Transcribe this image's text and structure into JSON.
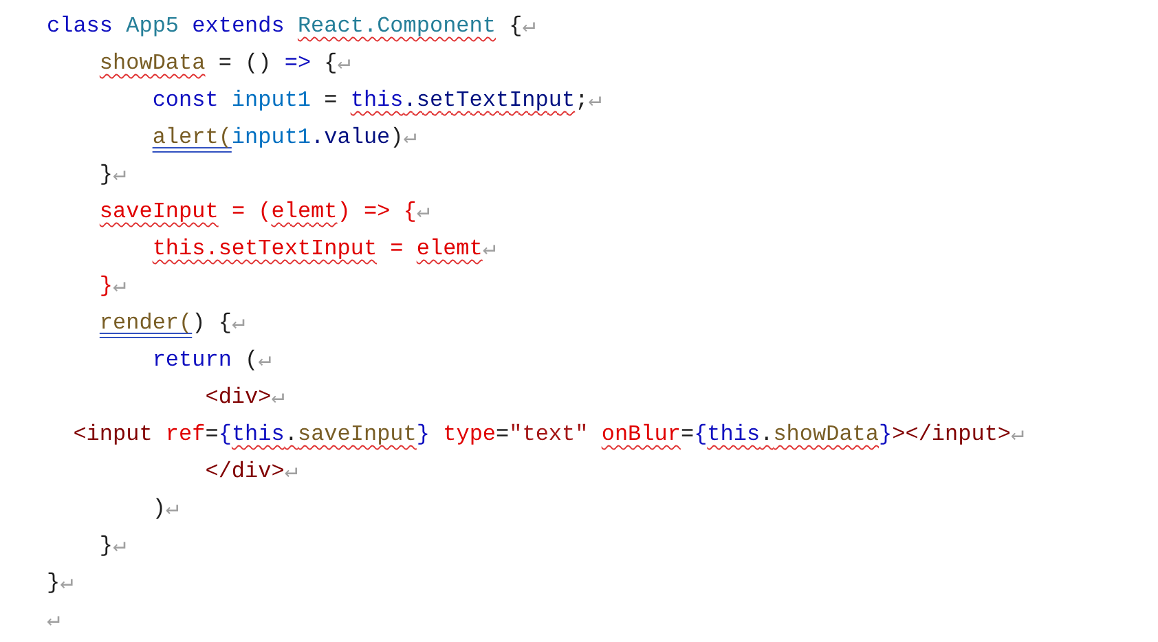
{
  "document": {
    "lines": [
      {
        "tokens": [
          {
            "text": "class",
            "color": "#1010c0"
          },
          {
            "text": " App5",
            "color": "#267f99"
          },
          {
            "text": " extends ",
            "color": "#1010c0"
          },
          {
            "text": "React.Component",
            "color": "#267f99",
            "kind": "spell"
          },
          {
            "text": " {",
            "color": "#1e1e1e"
          },
          {
            "text": "↵",
            "color": "#a0a0a0"
          }
        ]
      },
      {
        "tokens": [
          {
            "text": "    showData",
            "color": "#795e26",
            "kind": "spell"
          },
          {
            "text": " = () ",
            "color": "#1e1e1e"
          },
          {
            "text": "=>",
            "color": "#1010c0"
          },
          {
            "text": " {",
            "color": "#1e1e1e"
          },
          {
            "text": "↵",
            "color": "#a0a0a0"
          }
        ]
      },
      {
        "tokens": [
          {
            "text": "        const ",
            "color": "#1010c0"
          },
          {
            "text": "input1",
            "color": "#0070c1"
          },
          {
            "text": " = ",
            "color": "#1e1e1e"
          },
          {
            "text": "this",
            "color": "#1010c0",
            "kind": "spell"
          },
          {
            "text": ".setTextInput",
            "color": "#001080",
            "kind": "spell"
          },
          {
            "text": ";",
            "color": "#1e1e1e"
          },
          {
            "text": "↵",
            "color": "#a0a0a0"
          }
        ]
      },
      {
        "tokens": [
          {
            "text": "        alert(",
            "color": "#795e26",
            "kind": "grammar"
          },
          {
            "text": "input1",
            "color": "#0070c1"
          },
          {
            "text": ".value",
            "color": "#001080"
          },
          {
            "text": ")",
            "color": "#1e1e1e"
          },
          {
            "text": "↵",
            "color": "#a0a0a0"
          }
        ]
      },
      {
        "tokens": [
          {
            "text": "    }",
            "color": "#1e1e1e"
          },
          {
            "text": "↵",
            "color": "#a0a0a0"
          }
        ]
      },
      {
        "tokens": [
          {
            "text": "    saveInput",
            "color": "#e00000",
            "kind": "spell"
          },
          {
            "text": " = (",
            "color": "#e00000"
          },
          {
            "text": "elemt",
            "color": "#e00000",
            "kind": "spell"
          },
          {
            "text": ") => {",
            "color": "#e00000"
          },
          {
            "text": "↵",
            "color": "#a0a0a0"
          }
        ]
      },
      {
        "tokens": [
          {
            "text": "        this.setTextInput",
            "color": "#e00000",
            "kind": "spell"
          },
          {
            "text": " = ",
            "color": "#e00000"
          },
          {
            "text": "elemt",
            "color": "#e00000",
            "kind": "spell"
          },
          {
            "text": "↵",
            "color": "#a0a0a0"
          }
        ]
      },
      {
        "tokens": [
          {
            "text": "    }",
            "color": "#e00000"
          },
          {
            "text": "↵",
            "color": "#a0a0a0"
          }
        ]
      },
      {
        "tokens": [
          {
            "text": "    render(",
            "color": "#795e26",
            "kind": "grammar"
          },
          {
            "text": ") {",
            "color": "#1e1e1e"
          },
          {
            "text": "↵",
            "color": "#a0a0a0"
          }
        ]
      },
      {
        "tokens": [
          {
            "text": "        return",
            "color": "#1010c0"
          },
          {
            "text": " (",
            "color": "#1e1e1e"
          },
          {
            "text": "↵",
            "color": "#a0a0a0"
          }
        ]
      },
      {
        "tokens": [
          {
            "text": "            <div>",
            "color": "#800000"
          },
          {
            "text": "↵",
            "color": "#a0a0a0"
          }
        ]
      },
      {
        "tokens": [
          {
            "text": "  <input",
            "color": "#800000"
          },
          {
            "text": " ref",
            "color": "#e00000"
          },
          {
            "text": "=",
            "color": "#1e1e1e"
          },
          {
            "text": "{",
            "color": "#1010c0"
          },
          {
            "text": "this",
            "color": "#1010c0",
            "kind": "spell"
          },
          {
            "text": ".",
            "color": "#1e1e1e",
            "kind": "spell"
          },
          {
            "text": "saveInput",
            "color": "#795e26",
            "kind": "spell"
          },
          {
            "text": "}",
            "color": "#1010c0"
          },
          {
            "text": " type",
            "color": "#e00000"
          },
          {
            "text": "=",
            "color": "#1e1e1e"
          },
          {
            "text": "\"text\" ",
            "color": "#a31515"
          },
          {
            "text": "onBlur",
            "color": "#e00000",
            "kind": "spell"
          },
          {
            "text": "=",
            "color": "#1e1e1e"
          },
          {
            "text": "{",
            "color": "#1010c0"
          },
          {
            "text": "this",
            "color": "#1010c0",
            "kind": "spell"
          },
          {
            "text": ".",
            "color": "#1e1e1e",
            "kind": "spell"
          },
          {
            "text": "showData",
            "color": "#795e26",
            "kind": "spell"
          },
          {
            "text": "}",
            "color": "#1010c0"
          },
          {
            "text": "></input>",
            "color": "#800000"
          },
          {
            "text": "↵",
            "color": "#a0a0a0"
          }
        ]
      },
      {
        "tokens": [
          {
            "text": "            </div>",
            "color": "#800000"
          },
          {
            "text": "↵",
            "color": "#a0a0a0"
          }
        ]
      },
      {
        "tokens": [
          {
            "text": "        )",
            "color": "#1e1e1e"
          },
          {
            "text": "↵",
            "color": "#a0a0a0"
          }
        ]
      },
      {
        "tokens": [
          {
            "text": "    }",
            "color": "#1e1e1e"
          },
          {
            "text": "↵",
            "color": "#a0a0a0"
          }
        ]
      },
      {
        "tokens": [
          {
            "text": "}",
            "color": "#1e1e1e"
          },
          {
            "text": "↵",
            "color": "#a0a0a0"
          }
        ]
      },
      {
        "tokens": [
          {
            "text": "↵",
            "color": "#a0a0a0"
          }
        ]
      }
    ]
  }
}
